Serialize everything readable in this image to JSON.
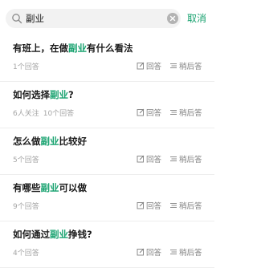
{
  "search": {
    "query": "副业",
    "placeholder": "",
    "cancel_label": "取消"
  },
  "actions": {
    "answer_label": "回答",
    "later_label": "稍后答"
  },
  "results": [
    {
      "title_pre": "有班上，在做",
      "title_hl": "副业",
      "title_post": "有什么看法",
      "meta": [
        "1个回答"
      ]
    },
    {
      "title_pre": "如何选择",
      "title_hl": "副业",
      "title_post": "?",
      "meta": [
        "6人关注",
        "10个回答"
      ]
    },
    {
      "title_pre": "怎么做",
      "title_hl": "副业",
      "title_post": "比较好",
      "meta": [
        "5个回答"
      ]
    },
    {
      "title_pre": "有哪些",
      "title_hl": "副业",
      "title_post": "可以做",
      "meta": [
        "9个回答"
      ]
    },
    {
      "title_pre": "如何通过",
      "title_hl": "副业",
      "title_post": "挣钱?",
      "meta": [
        "4个回答"
      ]
    }
  ],
  "colors": {
    "accent": "#18a26f",
    "text": "#1a1a1a",
    "muted": "#a6a6a6"
  },
  "icons": [
    "search-icon",
    "clear-icon",
    "edit-icon",
    "list-icon"
  ]
}
